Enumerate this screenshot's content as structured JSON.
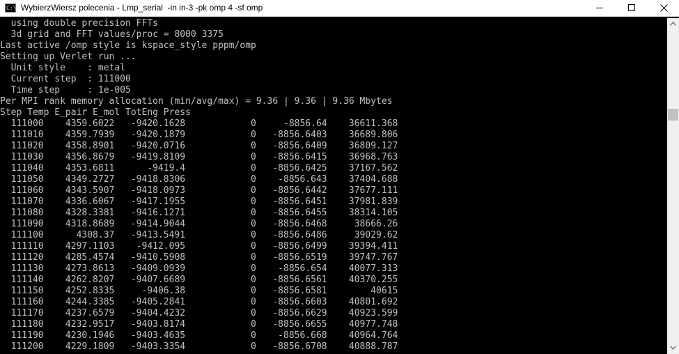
{
  "window": {
    "title": "WybierzWiersz polecenia - Lmp_serial  -in in-3 -pk omp 4 -sf omp",
    "icon": "cmd-icon"
  },
  "console": {
    "lines": [
      "  using double precision FFTs",
      "  3d grid and FFT values/proc = 8000 3375",
      "Last active /omp style is kspace_style pppm/omp",
      "Setting up Verlet run ...",
      "  Unit style    : metal",
      "  Current step  : 111000",
      "  Time step     : 1e-005",
      "Per MPI rank memory allocation (min/avg/max) = 9.36 | 9.36 | 9.36 Mbytes",
      "Step Temp E_pair E_mol TotEng Press",
      "  111000    4359.6022   -9420.1628            0     -8856.64    36611.368",
      "  111010    4359.7939   -9420.1879            0   -8856.6403    36689.806",
      "  111020    4358.8901   -9420.0716            0   -8856.6409    36809.127",
      "  111030    4356.8679   -9419.8109            0   -8856.6415    36968.763",
      "  111040    4353.6811      -9419.4            0   -8856.6425    37167.562",
      "  111050    4349.2727   -9418.8306            0    -8856.643    37404.688",
      "  111060    4343.5907   -9418.0973            0   -8856.6442    37677.111",
      "  111070    4336.6067   -9417.1955            0   -8856.6451    37981.839",
      "  111080    4328.3381   -9416.1271            0   -8856.6455    38314.105",
      "  111090    4318.8689   -9414.9044            0   -8856.6468     38666.26",
      "  111100      4308.37   -9413.5491            0   -8856.6486     39029.62",
      "  111110    4297.1103    -9412.095            0   -8856.6499    39394.411",
      "  111120    4285.4574   -9410.5908            0   -8856.6519    39747.767",
      "  111130    4273.8613   -9409.0939            0    -8856.654    40077.313",
      "  111140    4262.8207   -9407.6689            0   -8856.6561    40370.255",
      "  111150    4252.8335     -9406.38            0   -8856.6581        40615",
      "  111160    4244.3385   -9405.2841            0   -8856.6603    40801.692",
      "  111170    4237.6579   -9404.4232            0   -8856.6629    40923.599",
      "  111180    4232.9517   -9403.8174            0   -8856.6655    40977.748",
      "  111190    4230.1946   -9403.4635            0    -8856.668    40964.764",
      "  111200    4229.1809   -9403.3354            0   -8856.6708    40888.787"
    ]
  },
  "colors": {
    "console_bg": "#000000",
    "console_fg": "#c0c0c0",
    "titlebar_bg": "#ffffff",
    "scrollbar_track": "#f0f0f0",
    "scrollbar_thumb": "#c1c1c1"
  },
  "icons": {
    "minimize": "minimize-icon",
    "maximize": "maximize-icon",
    "close": "close-icon",
    "scroll_up": "scroll-up-icon",
    "scroll_down": "scroll-down-icon"
  }
}
